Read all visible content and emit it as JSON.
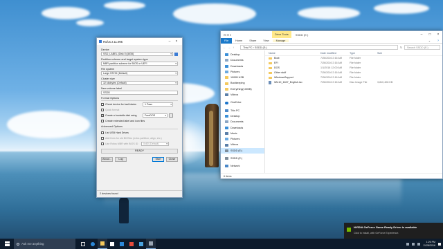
{
  "rufus": {
    "title": "Rufus 2.11.995",
    "device_label": "Device",
    "device_value": "SSD_LABEL (Disk 0) [8GB]",
    "partition_label": "Partition scheme and target system type",
    "partition_value": "MBR partition scheme for BIOS or UEFI",
    "filesystem_label": "File system",
    "filesystem_value": "Large FAT32 (Default)",
    "cluster_label": "Cluster size",
    "cluster_value": "32 kilobytes (Default)",
    "volume_label": "New volume label",
    "volume_value": "SSDD",
    "format_options_label": "Format Options",
    "check_bad_blocks_label": "Check device for bad blocks",
    "check_bad_blocks_passes": "1 Pass",
    "quick_format_label": "Quick format",
    "create_bootable_label": "Create a bootable disk using",
    "create_bootable_value": "FreeDOS",
    "extended_label_label": "Create extended label and icon files",
    "advanced_options_label": "Advanced Options",
    "list_usb_label": "List USB Hard Drives",
    "add_fixes_label": "Add fixes for old BIOSes (extra partition, align, etc.)",
    "use_rufus_mbr_label": "Use Rufus MBR with BIOS ID",
    "bios_id_value": "0x80 (Default)",
    "status": "READY",
    "about_button": "About...",
    "log_button": "Log",
    "start_button": "Start",
    "close_button": "Close",
    "footer": "2 devices found"
  },
  "explorer": {
    "qat": "⊡ ⊡ ▾",
    "context_tab": "Drive Tools",
    "window_title": "SSDD (E:)",
    "tabs": {
      "file": "File",
      "home": "Home",
      "share": "Share",
      "view": "View",
      "manage": "Manage"
    },
    "path": "This PC  ›  SSDD (E:)",
    "search_placeholder": "Search SSDD (E:)",
    "nav": {
      "desktop": "Desktop",
      "documents": "Documents",
      "downloads": "Downloads",
      "pictures": "Pictures",
      "folder1": "1000B USB",
      "folder2": "Bootkeeping",
      "folder3": "Everything(1000B)",
      "videos": "Videos",
      "onedrive": "OneDrive",
      "thispc": "This PC",
      "pc_desktop": "Desktop",
      "pc_documents": "Documents",
      "pc_downloads": "Downloads",
      "pc_music": "Music",
      "pc_pictures": "Pictures",
      "pc_videos": "Videos",
      "pc_ssdd": "SSDD (E:)",
      "ssdd": "SSDD (E:)",
      "network": "Network"
    },
    "columns": {
      "name": "Name",
      "date": "Date modified",
      "type": "Type",
      "size": "Size"
    },
    "files": [
      {
        "name": "Boot",
        "date": "7/26/2016 2:16 AM",
        "type": "File folder",
        "size": ""
      },
      {
        "name": "EFI",
        "date": "7/26/2016 2:16 AM",
        "type": "File folder",
        "size": ""
      },
      {
        "name": "DOS",
        "date": "1/1/2016 12:00 AM",
        "type": "File folder",
        "size": ""
      },
      {
        "name": "Other stuff",
        "date": "7/26/2016 2:16 AM",
        "type": "File folder",
        "size": ""
      },
      {
        "name": "WindowsSupport",
        "date": "7/26/2016 2:16 AM",
        "type": "File folder",
        "size": ""
      },
      {
        "name": "Win10_1607_English.iso",
        "date": "7/26/2016 2:16 AM",
        "type": "Disc Image File",
        "size": "3,810,408 KB"
      }
    ],
    "status": "6 items"
  },
  "toast": {
    "title": "NVIDIA GeForce Game Ready Driver is available",
    "body": "Click to install, with GeForce Experience."
  },
  "taskbar": {
    "search_placeholder": "Ask me anything",
    "time": "1:26 PM",
    "date": "11/28/2016"
  },
  "colors": {
    "accent": "#0078d7",
    "file_tab": "#1979ca",
    "nvidia_green": "#76b900",
    "taskbar": "#0d1b2c"
  }
}
